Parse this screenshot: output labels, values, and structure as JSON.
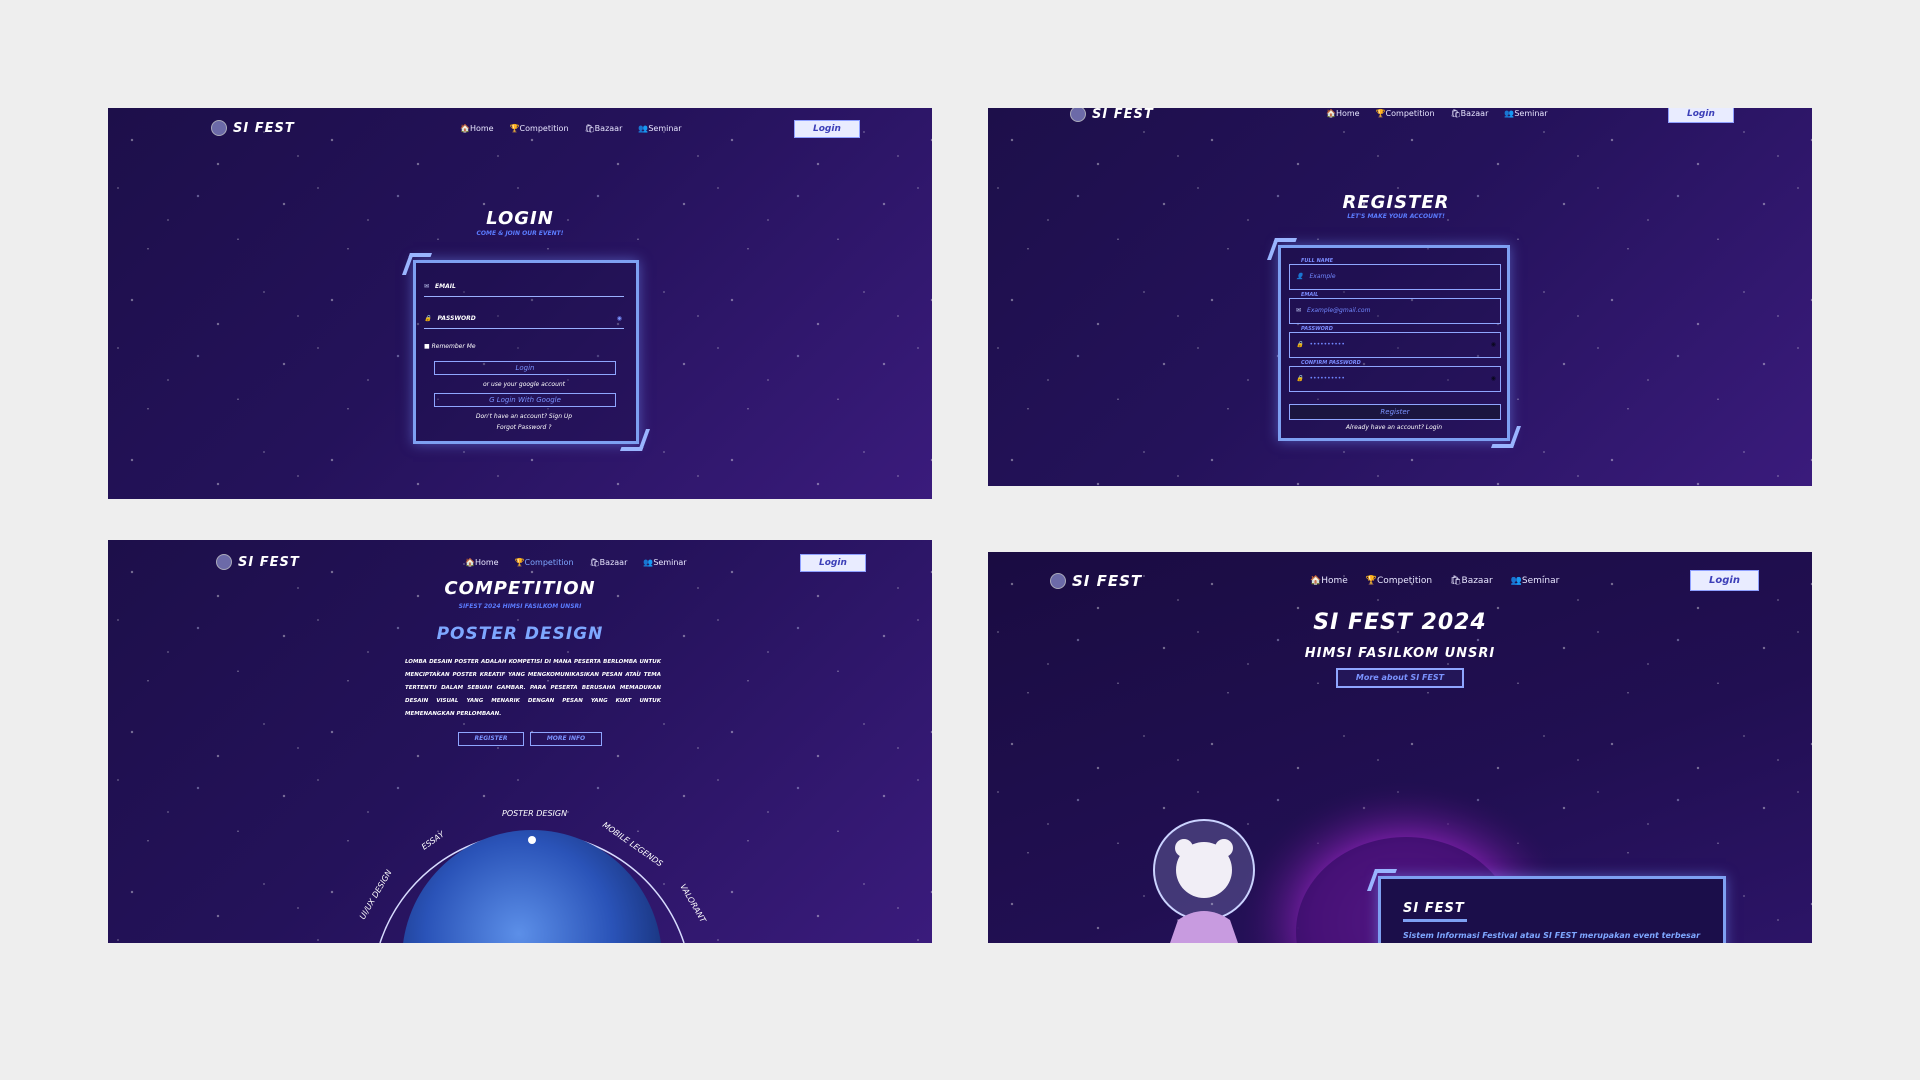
{
  "brand": {
    "logo_text": "SI FEST"
  },
  "nav": {
    "home": "🏠Home",
    "competition": "🏆Competition",
    "bazaar": "🛍Bazaar",
    "seminar": "👥Seminar",
    "login": "Login"
  },
  "login_page": {
    "title": "LOGIN",
    "subtitle": "COME & JOIN OUR EVENT!",
    "email_label": "EMAIL",
    "password_label": "PASSWORD",
    "remember": "Remember Me",
    "login_button": "Login",
    "or_text": "or use your google account",
    "google_button": "G Login With Google",
    "signup_text": "Don't have an account? Sign Up",
    "forgot_text": "Forgot Password ?"
  },
  "register_page": {
    "title": "REGISTER",
    "subtitle": "LET'S MAKE YOUR ACCOUNT!",
    "fullname_label": "FULL NAME",
    "fullname_placeholder": "Example",
    "email_label": "EMAIL",
    "email_placeholder": "Example@gmail.com",
    "password_label": "PASSWORD",
    "password_value": "••••••••••",
    "confirm_label": "CONFIRM PASSWORD",
    "confirm_value": "••••••••••",
    "register_button": "Register",
    "login_text": "Already have an account? Login"
  },
  "competition_page": {
    "title": "COMPETITION",
    "subtitle": "SIFEST 2024 HIMSI FASILKOM UNSRI",
    "event_title": "POSTER DESIGN",
    "description": "LOMBA DESAIN POSTER ADALAH KOMPETISI DI MANA PESERTA BERLOMBA UNTUK MENCIPTAKAN POSTER KREATIF YANG MENGKOMUNIKASIKAN PESAN ATAU TEMA TERTENTU DALAM SEBUAH GAMBAR. PARA PESERTA BERUSAHA MEMADUKAN DESAIN VISUAL YANG MENARIK DENGAN PESAN YANG KUAT UNTUK MEMENANGKAN PERLOMBAAN.",
    "register_button": "REGISTER",
    "info_button": "MORE INFO",
    "orbit_labels": [
      "UI/UX DESIGN",
      "ESSAY",
      "POSTER DESIGN",
      "MOBILE LEGENDS",
      "VALORANT"
    ]
  },
  "home_page": {
    "title": "SI FEST 2024",
    "subtitle": "HIMSI FASILKOM UNSRI",
    "more_button": "More about SI FEST",
    "card_title": "SI FEST",
    "card_text": "Sistem Informasi Festival atau SI FEST merupakan event terbesar"
  },
  "colors": {
    "accent": "#7ea0f2",
    "background": "#24125a",
    "page": "#eeeeee"
  }
}
